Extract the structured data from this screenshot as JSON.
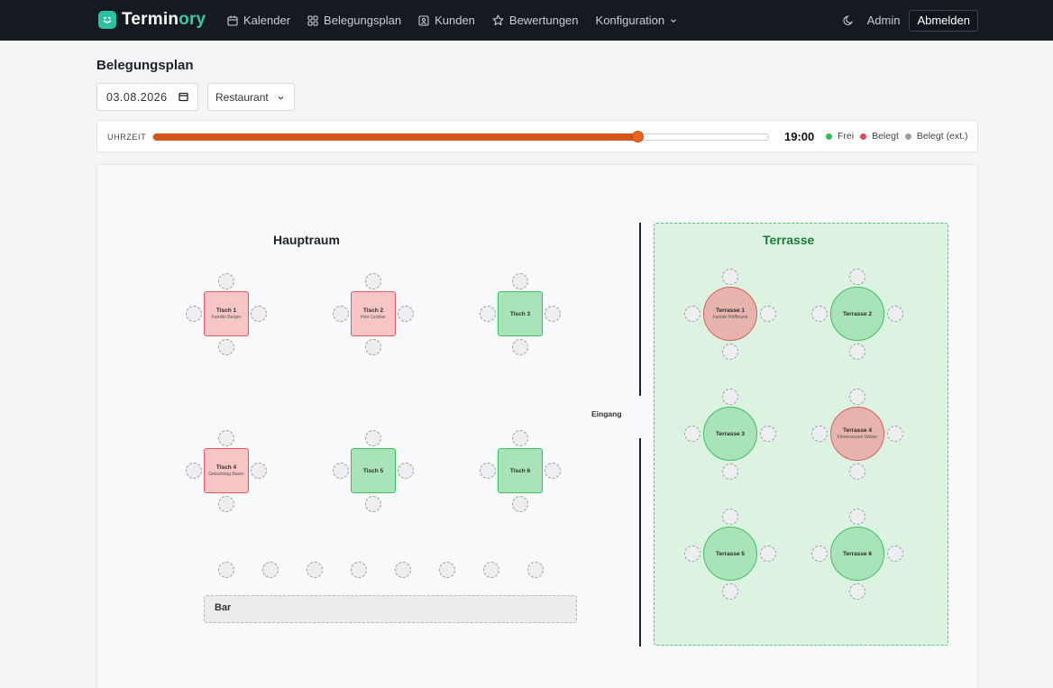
{
  "app": {
    "brand_prefix": "Termin",
    "brand_suffix": "ory",
    "accent_color": "#35c9a6"
  },
  "nav": {
    "items": [
      {
        "label": "Kalender",
        "icon": "calendar-icon"
      },
      {
        "label": "Belegungsplan",
        "icon": "grid-icon"
      },
      {
        "label": "Kunden",
        "icon": "contact-icon"
      },
      {
        "label": "Bewertungen",
        "icon": "star-icon"
      },
      {
        "label": "Konfiguration",
        "icon": "chevron-down-icon"
      }
    ],
    "user": "Admin",
    "logout": "Abmelden"
  },
  "page": {
    "title": "Belegungsplan",
    "date": "03.08.2026",
    "location": "Restaurant"
  },
  "timebar": {
    "label": "UHRZEIT",
    "time": "19:00",
    "slider_fraction": 0.787,
    "slider_color": "#d4541a",
    "legend": [
      {
        "label": "Frei",
        "color": "#2fbf55"
      },
      {
        "label": "Belegt",
        "color": "#e5484d"
      },
      {
        "label": "Belegt (ext.)",
        "color": "#9aa0a6"
      }
    ]
  },
  "plan": {
    "main_room": "Hauptraum",
    "terrace": "Terrasse",
    "entrance": "Eingang",
    "bar": "Bar",
    "tables": [
      {
        "name": "Tisch 1",
        "guest": "Familie Berger",
        "status": "belegt"
      },
      {
        "name": "Tisch 2",
        "guest": "Herr Lindner",
        "status": "belegt"
      },
      {
        "name": "Tisch 3",
        "guest": "",
        "status": "frei"
      },
      {
        "name": "Tisch 4",
        "guest": "Geburtstag Bauer",
        "status": "belegt"
      },
      {
        "name": "Tisch 5",
        "guest": "",
        "status": "frei"
      },
      {
        "name": "Tisch 6",
        "guest": "",
        "status": "frei"
      }
    ],
    "terrace_tables": [
      {
        "name": "Terrasse 1",
        "guest": "Familie Hoffmann",
        "status": "belegt"
      },
      {
        "name": "Terrasse 2",
        "guest": "",
        "status": "frei"
      },
      {
        "name": "Terrasse 3",
        "guest": "",
        "status": "frei"
      },
      {
        "name": "Terrasse 4",
        "guest": "Firmenessen Weber",
        "status": "belegt"
      },
      {
        "name": "Terrasse 5",
        "guest": "",
        "status": "frei"
      },
      {
        "name": "Terrasse 6",
        "guest": "",
        "status": "frei"
      }
    ]
  }
}
